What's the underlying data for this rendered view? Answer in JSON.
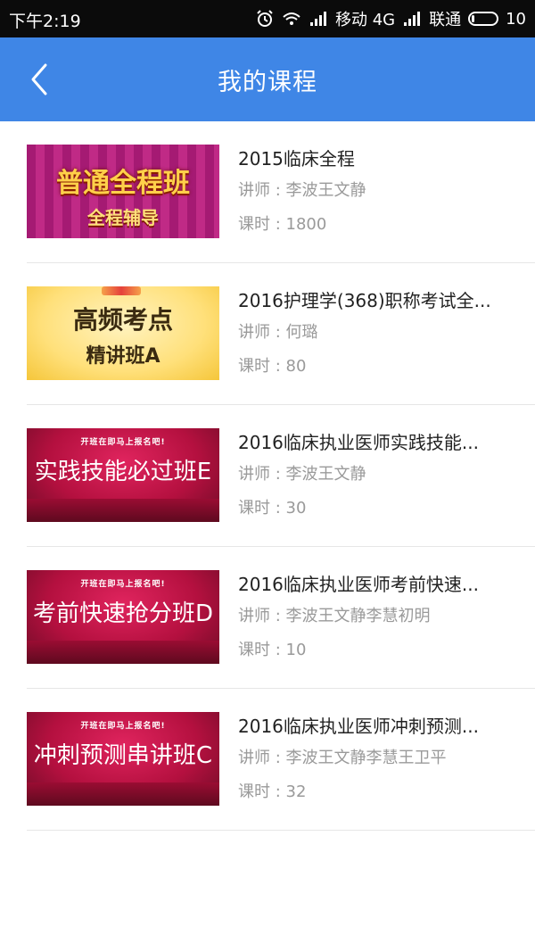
{
  "status_bar": {
    "time": "下午2:19",
    "carrier1": "移动 4G",
    "carrier2": "联通",
    "battery": "10"
  },
  "header": {
    "title": "我的课程"
  },
  "courses": [
    {
      "title": "2015临床全程",
      "teacher": "讲师 : 李波王文静",
      "hours": "课时 : 1800",
      "banner_line1": "普通全程班",
      "banner_line2": "全程辅导"
    },
    {
      "title": "2016护理学(368)职称考试全...",
      "teacher": "讲师 : 何璐",
      "hours": "课时 : 80",
      "banner_line1": "高频考点",
      "banner_line2": "精讲班A"
    },
    {
      "title": "2016临床执业医师实践技能...",
      "teacher": "讲师 : 李波王文静",
      "hours": "课时 : 30",
      "banner_small": "开班在即马上报名吧!",
      "banner_big": "实践技能必过班E"
    },
    {
      "title": "2016临床执业医师考前快速...",
      "teacher": "讲师 : 李波王文静李慧初明",
      "hours": "课时 : 10",
      "banner_small": "开班在即马上报名吧!",
      "banner_big": "考前快速抢分班D"
    },
    {
      "title": "2016临床执业医师冲刺预测...",
      "teacher": "讲师 : 李波王文静李慧王卫平",
      "hours": "课时 : 32",
      "banner_small": "开班在即马上报名吧!",
      "banner_big": "冲刺预测串讲班C"
    }
  ],
  "colors": {
    "header_bg": "#3f86e6",
    "status_bg": "#0b0b0b",
    "title_text": "#222222",
    "meta_text": "#9a9a9a"
  }
}
